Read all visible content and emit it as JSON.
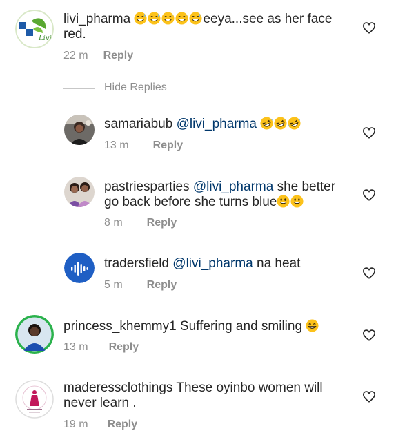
{
  "comments": [
    {
      "username": "livi_pharma",
      "mention": "",
      "text": "eeya...see as her face red.",
      "emoji_before_text": [
        "grin-sweat",
        "grin-sweat",
        "grin-sweat",
        "grin-sweat",
        "grin-sweat"
      ],
      "time": "22 m",
      "reply_label": "Reply"
    }
  ],
  "hide_replies_label": "Hide Replies",
  "replies": [
    {
      "username": "samariabub",
      "mention": "@livi_pharma",
      "text": "",
      "emoji_after_text": [
        "rofl",
        "rofl",
        "rofl"
      ],
      "time": "13 m",
      "reply_label": "Reply"
    },
    {
      "username": "pastriesparties",
      "mention": "@livi_pharma",
      "text": "she better go back before she turns blue",
      "emoji_after_text": [
        "grin",
        "grin"
      ],
      "time": "8 m",
      "reply_label": "Reply"
    },
    {
      "username": "tradersfield",
      "mention": "@livi_pharma",
      "text": "na heat",
      "time": "5 m",
      "reply_label": "Reply"
    }
  ],
  "more_comments": [
    {
      "username": "princess_khemmy1",
      "text": "Suffering and smiling",
      "emoji_after_text": [
        "grin-teeth"
      ],
      "time": "13 m",
      "reply_label": "Reply"
    },
    {
      "username": "maderessclothings",
      "text": "These oyinbo women will never learn .",
      "time": "19 m",
      "reply_label": "Reply"
    }
  ],
  "avatar_labels": {
    "livi": "Livi"
  },
  "icons": {
    "like": "heart-outline-icon"
  },
  "colors": {
    "text": "#262626",
    "muted": "#8e8e8e",
    "mention": "#00376b",
    "emoji_yellow": "#fcc21b"
  }
}
